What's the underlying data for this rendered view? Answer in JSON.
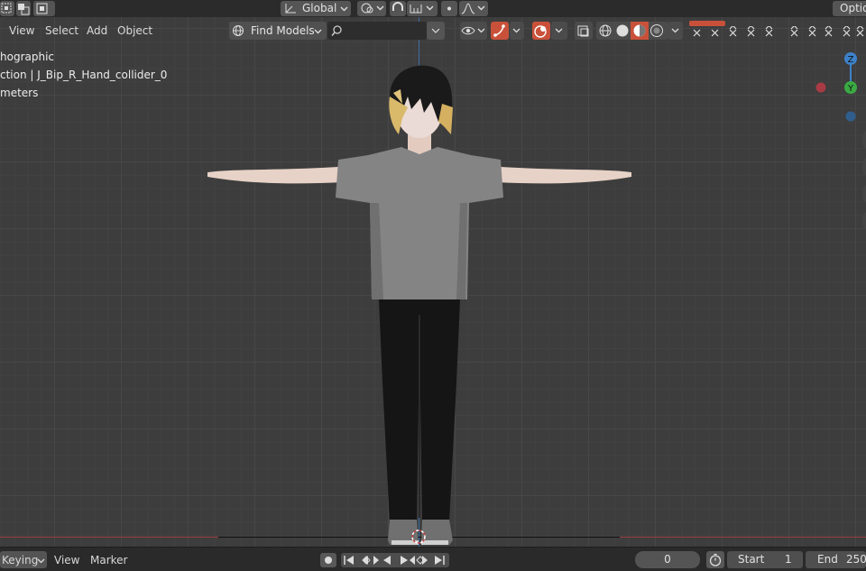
{
  "header": {
    "transform_orientation": "Global",
    "options_label": "Option"
  },
  "viewport_header": {
    "menu": [
      "View",
      "Select",
      "Add",
      "Object"
    ],
    "collection_selector": "Find Models",
    "search_placeholder": ""
  },
  "overlay": {
    "view_name": "hographic",
    "object_info": "ction | J_Bip_R_Hand_collider_0",
    "units": "meters"
  },
  "gizmo": {
    "z_label": "Z",
    "y_label": "Y"
  },
  "timeline": {
    "keying_label": "Keying",
    "view_label": "View",
    "marker_label": "Marker",
    "current_frame": "0",
    "start_label": "Start",
    "start_value": "1",
    "end_label": "End",
    "end_value": "250"
  },
  "colors": {
    "accent_red": "#c9513a",
    "axis_red": "#a83a44",
    "axis_green": "#3aaa43",
    "axis_blue": "#3d82c9"
  }
}
